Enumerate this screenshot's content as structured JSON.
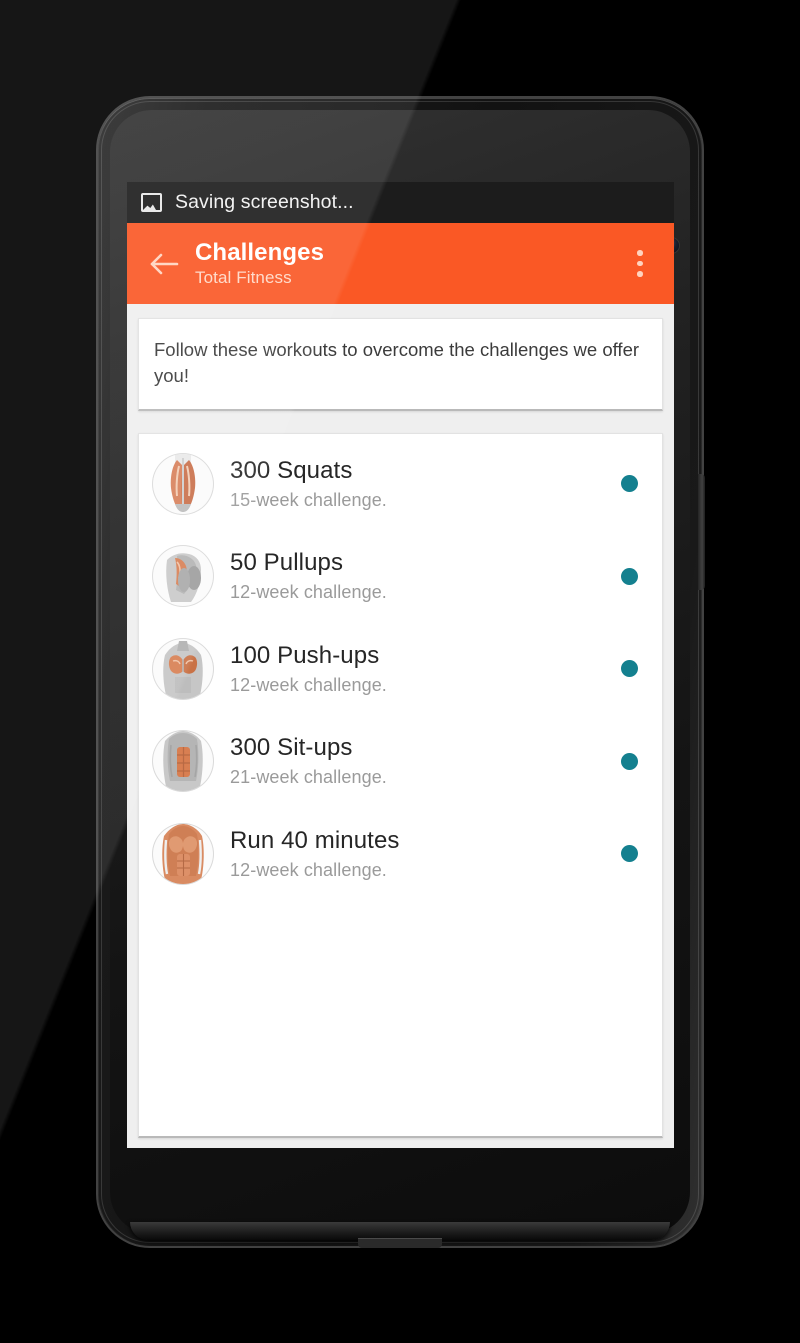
{
  "status_bar": {
    "icon": "image-screenshot-icon",
    "text": "Saving screenshot..."
  },
  "app_bar": {
    "back_icon": "arrow-back-icon",
    "title": "Challenges",
    "subtitle": "Total Fitness",
    "overflow_icon": "overflow-menu-icon",
    "background_color": "#fa5825"
  },
  "description": {
    "text": "Follow these workouts to overcome the challenges we offer you!"
  },
  "challenges": {
    "dot_color": "#14808f",
    "items": [
      {
        "title": "300 Squats",
        "subtitle": "15-week challenge.",
        "thumb": "quadriceps-muscle-icon",
        "status": "available"
      },
      {
        "title": "50 Pullups",
        "subtitle": "12-week challenge.",
        "thumb": "back-lats-muscle-icon",
        "status": "available"
      },
      {
        "title": "100 Push-ups",
        "subtitle": "12-week challenge.",
        "thumb": "chest-muscle-icon",
        "status": "available"
      },
      {
        "title": "300 Sit-ups",
        "subtitle": "21-week challenge.",
        "thumb": "abs-muscle-icon",
        "status": "available"
      },
      {
        "title": "Run 40 minutes",
        "subtitle": "12-week challenge.",
        "thumb": "full-torso-muscle-icon",
        "status": "available"
      }
    ]
  },
  "device": {
    "earpiece": "earpiece-speaker",
    "front_camera": "front-camera",
    "bottom_speaker": "bottom-speaker",
    "side_button": "power-button"
  }
}
